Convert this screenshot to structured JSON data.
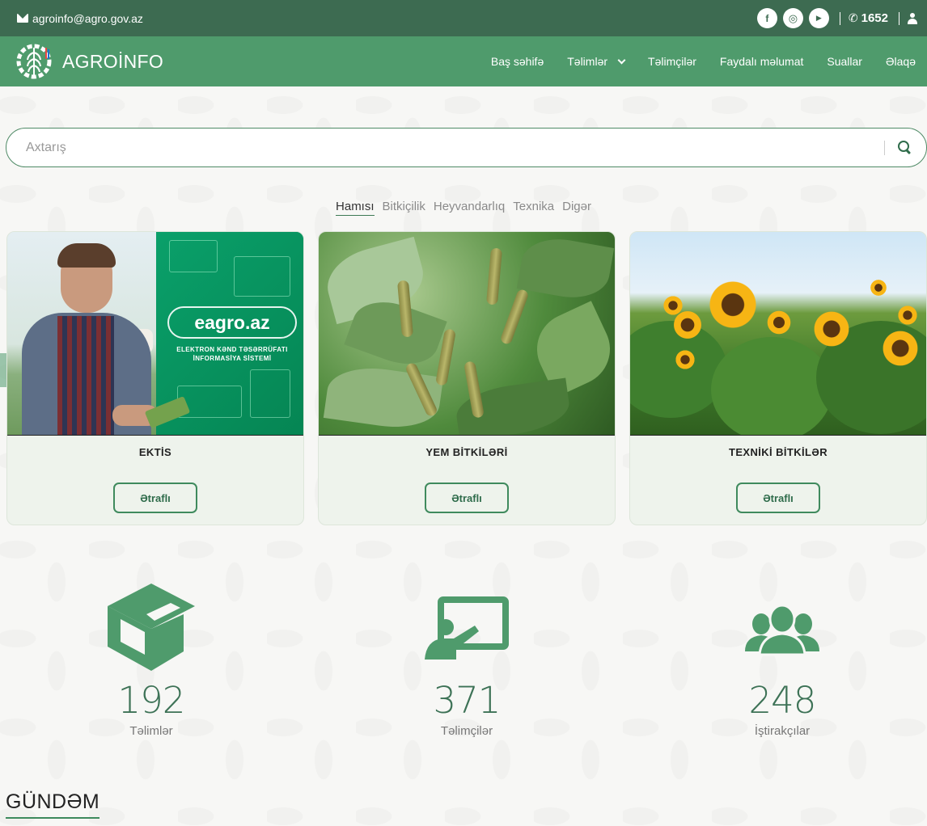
{
  "topbar": {
    "email": "agroinfo@agro.gov.az",
    "social": [
      {
        "name": "facebook-icon",
        "glyph": "f"
      },
      {
        "name": "instagram-icon",
        "glyph": "◎"
      },
      {
        "name": "youtube-icon",
        "glyph": "▶"
      }
    ],
    "phone": "1652"
  },
  "navbar": {
    "brand": "AGROİNFO",
    "items": [
      {
        "label": "Baş səhifə"
      },
      {
        "label": "Təlimlər",
        "dropdown": true
      },
      {
        "label": "Təlimçilər"
      },
      {
        "label": "Faydalı məlumat"
      },
      {
        "label": "Suallar"
      },
      {
        "label": "Əlaqə"
      }
    ]
  },
  "search": {
    "placeholder": "Axtarış",
    "value": ""
  },
  "filters": {
    "items": [
      "Hamısı",
      "Bitkiçilik",
      "Heyvandarlıq",
      "Texnika",
      "Digər"
    ],
    "active": "Hamısı"
  },
  "cards": [
    {
      "title": "EKTİS",
      "button": "Ətraflı",
      "image": {
        "badge": "eagro.az",
        "caption_line1": "ELEKTRON KƏND TƏSƏRRÜFATI",
        "caption_line2": "İNFORMASİYA SİSTEMİ"
      }
    },
    {
      "title": "YEM BİTKİLƏRİ",
      "button": "Ətraflı"
    },
    {
      "title": "TEXNİKİ BİTKİLƏR",
      "button": "Ətraflı"
    }
  ],
  "stats": [
    {
      "icon": "graduation-cap-icon",
      "value": "192",
      "label": "Təlimlər"
    },
    {
      "icon": "teacher-board-icon",
      "value": "371",
      "label": "Təlimçilər"
    },
    {
      "icon": "users-group-icon",
      "value": "248",
      "label": "İştirakçılar"
    }
  ],
  "agenda": {
    "title": "GÜNDƏM"
  },
  "colors": {
    "topbar": "#3d6b51",
    "navbar": "#4f9b6c",
    "accent": "#3d7256"
  }
}
